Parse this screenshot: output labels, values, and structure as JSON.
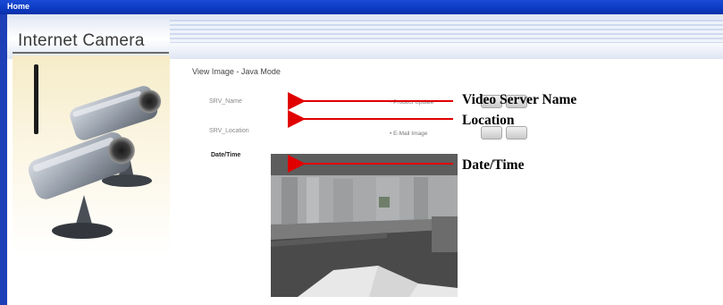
{
  "window": {
    "title": "Home"
  },
  "header": {
    "title": "Internet Camera"
  },
  "main": {
    "heading": "View Image - Java Mode",
    "rows": [
      {
        "label": "SRV_Name",
        "link": "• Product Update"
      },
      {
        "label": "SRV_Location",
        "link": "• E-Mail Image"
      }
    ],
    "datetime": "Date/Time"
  },
  "annotations": {
    "server_name": "Video Server  Name",
    "location": "Location",
    "datetime": "Date/Time"
  },
  "colors": {
    "title_bar": "#0d3bc4",
    "arrow": "#e00000",
    "sidebar": "#f6ecc9"
  },
  "icons": {
    "camera": "camera-illustration-icon"
  }
}
